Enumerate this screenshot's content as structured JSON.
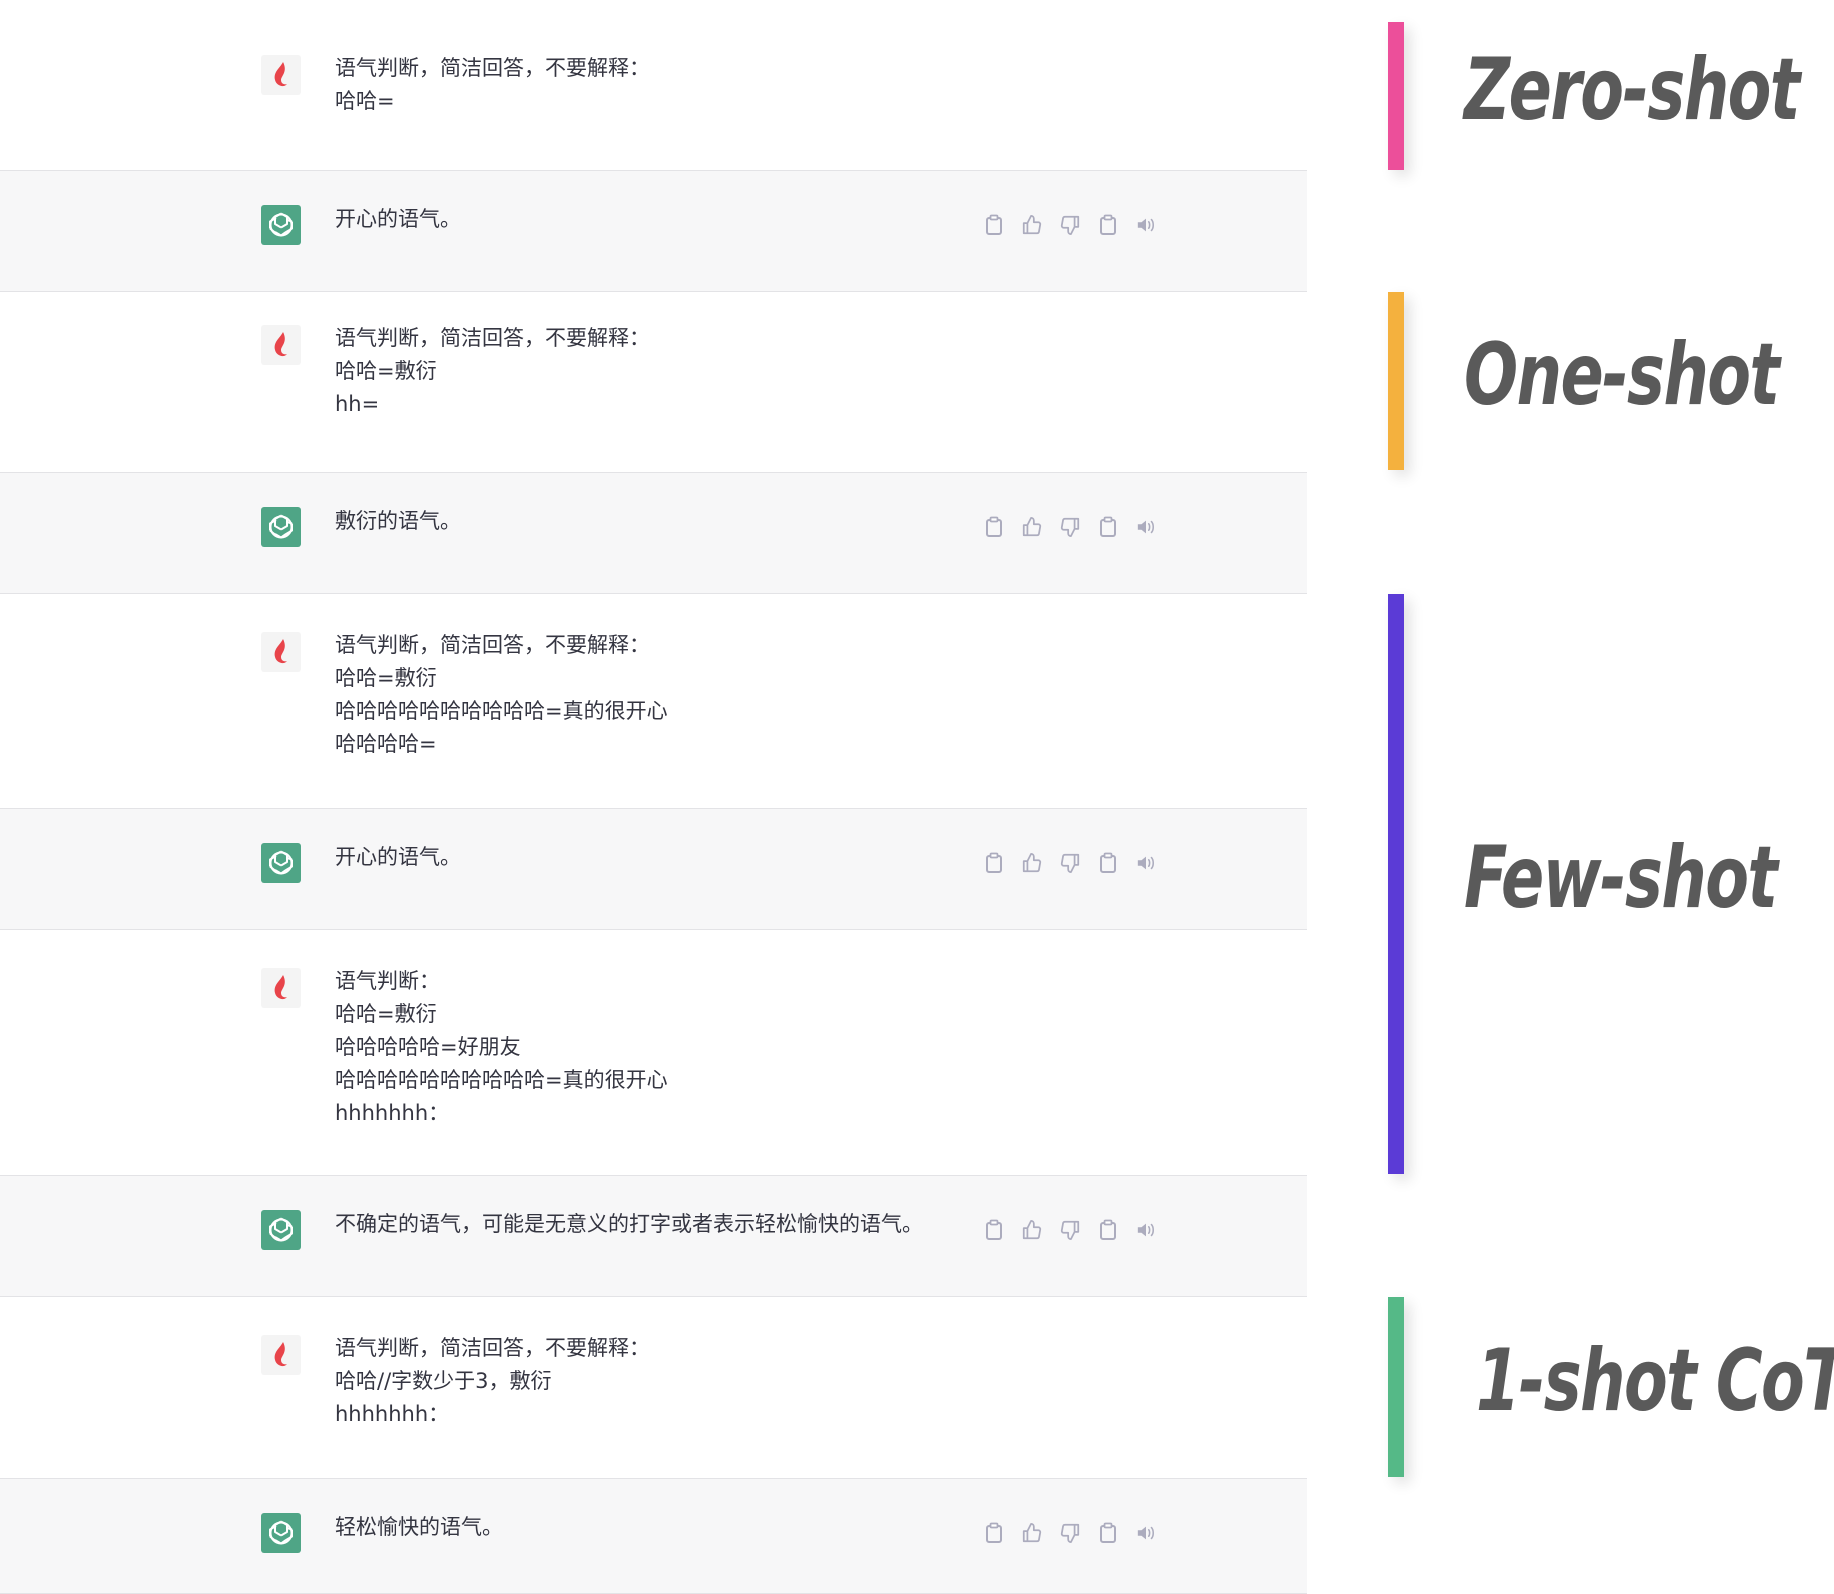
{
  "conversation": [
    {
      "role": "user",
      "text": "语气判断，简洁回答，不要解释：\n哈哈="
    },
    {
      "role": "assistant",
      "text": "开心的语气。"
    },
    {
      "role": "user",
      "text": "语气判断，简洁回答，不要解释：\n哈哈=敷衍\nhh="
    },
    {
      "role": "assistant",
      "text": "敷衍的语气。"
    },
    {
      "role": "user",
      "text": "语气判断，简洁回答，不要解释：\n哈哈=敷衍\n哈哈哈哈哈哈哈哈哈哈=真的很开心\n哈哈哈哈="
    },
    {
      "role": "assistant",
      "text": "开心的语气。"
    },
    {
      "role": "user",
      "text": "语气判断：\n哈哈=敷衍\n哈哈哈哈哈=好朋友\n哈哈哈哈哈哈哈哈哈哈=真的很开心\nhhhhhhh："
    },
    {
      "role": "assistant",
      "text": "不确定的语气，可能是无意义的打字或者表示轻松愉快的语气。"
    },
    {
      "role": "user",
      "text": "语气判断，简洁回答，不要解释：\n哈哈//字数少于3，敷衍\nhhhhhhh："
    },
    {
      "role": "assistant",
      "text": "轻松愉快的语气。"
    }
  ],
  "message_actions": [
    "copy-icon",
    "thumbs-up-icon",
    "thumbs-down-icon",
    "clipboard-icon",
    "speaker-icon"
  ],
  "labels": [
    {
      "text": "Zero-shot",
      "color": "#ec4f9a"
    },
    {
      "text": "One-shot",
      "color": "#f4b13e"
    },
    {
      "text": "Few-shot",
      "color": "#5b3bd6"
    },
    {
      "text": "1-shot CoT",
      "color": "#55b987"
    }
  ],
  "colors": {
    "assistant_avatar": "#4fa586",
    "user_avatar_flame": "#e8444a",
    "assistant_row_bg": "#f7f7f8",
    "text": "#343541",
    "icon": "#acacbe"
  }
}
